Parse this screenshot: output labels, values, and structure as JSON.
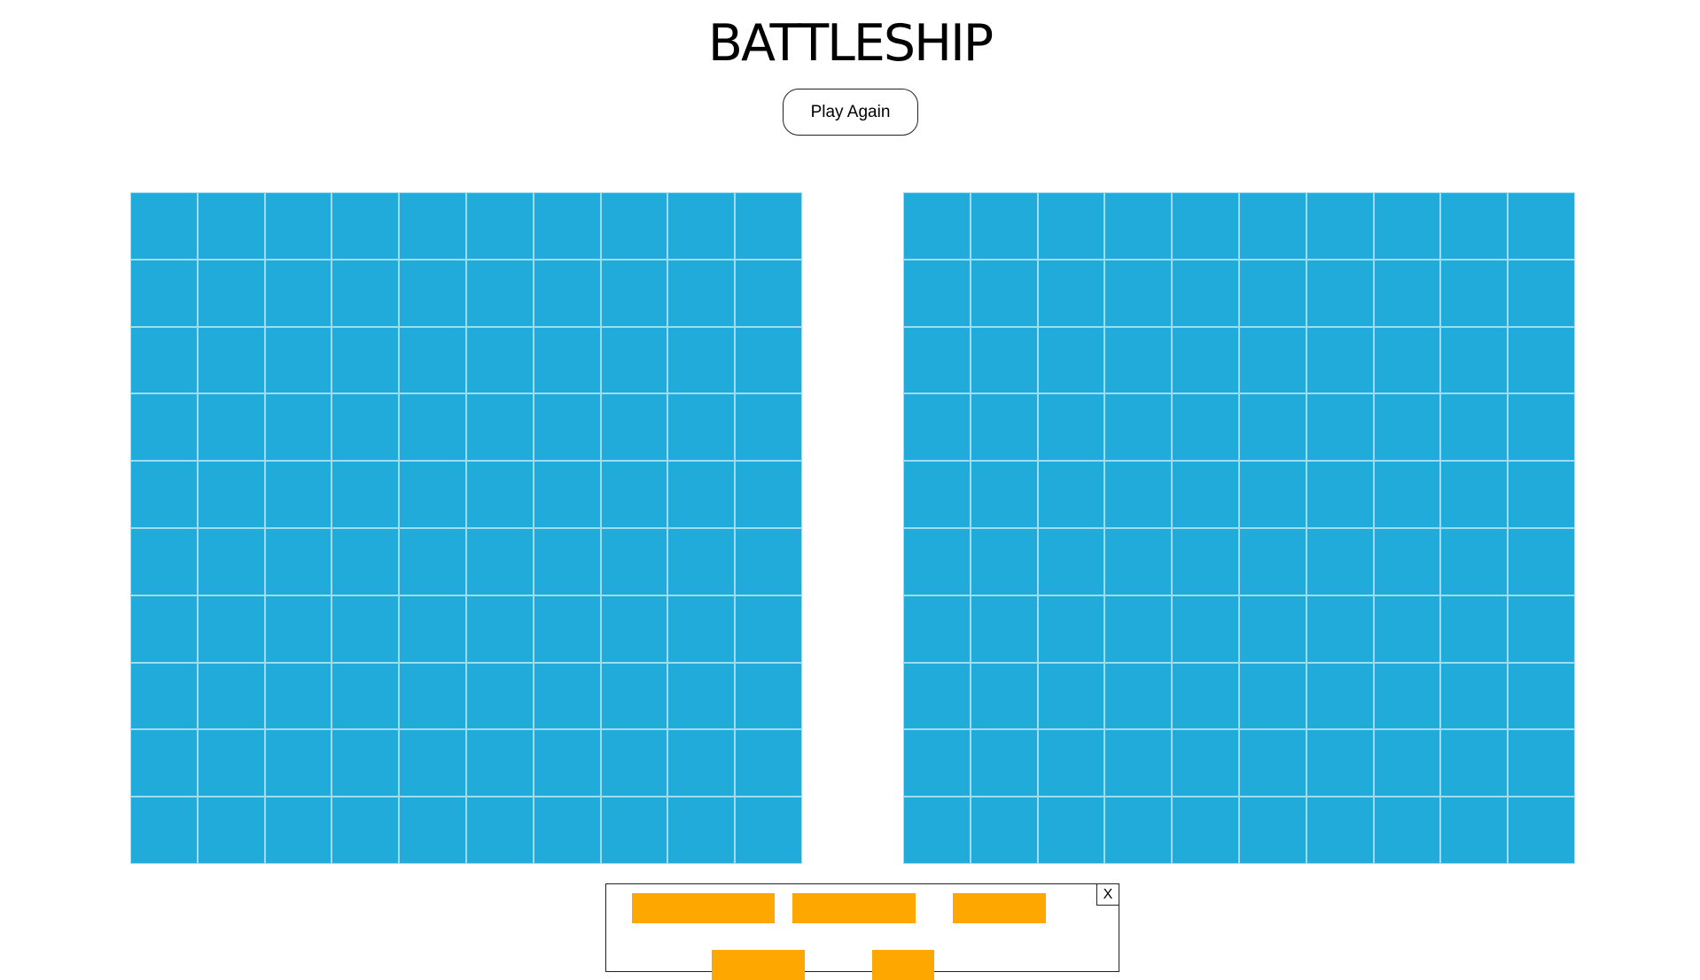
{
  "header": {
    "title": "BATTLESHIP",
    "play_again_label": "Play Again"
  },
  "boards": {
    "rows": 10,
    "cols": 10,
    "water_color": "#21abdb",
    "grid_line_color": "#9fdcf2"
  },
  "dock": {
    "close_label": "X",
    "ship_color": "#fea700",
    "ships": [
      {
        "name": "ship-carrier"
      },
      {
        "name": "ship-battleship"
      },
      {
        "name": "ship-cruiser"
      },
      {
        "name": "ship-submarine"
      },
      {
        "name": "ship-destroyer"
      }
    ]
  }
}
